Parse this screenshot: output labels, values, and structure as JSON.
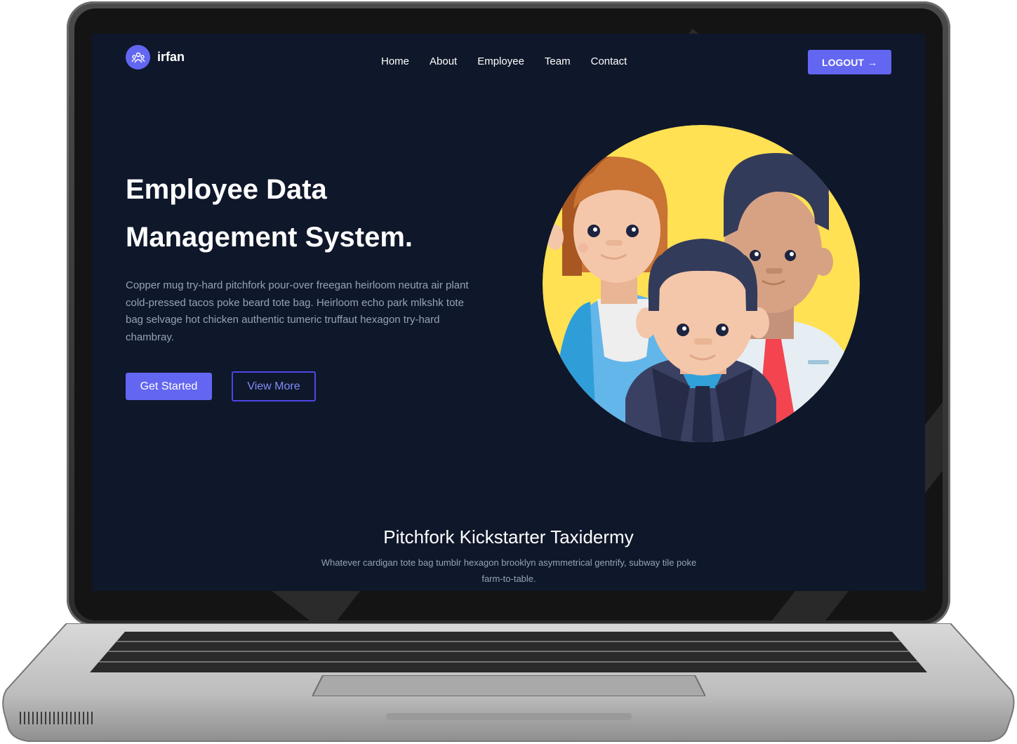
{
  "nav": {
    "brand": "irfan",
    "links": [
      "Home",
      "About",
      "Employee",
      "Team",
      "Contact"
    ],
    "logout_label": "LOGOUT",
    "logout_arrow": "→"
  },
  "hero": {
    "title_line1": "Employee Data",
    "title_line2": "Management System.",
    "description": "Copper mug try-hard pitchfork pour-over freegan heirloom neutra air plant cold-pressed tacos poke beard tote bag. Heirloom echo park mlkshk tote bag selvage hot chicken authentic tumeric truffaut hexagon try-hard chambray.",
    "primary_button": "Get Started",
    "secondary_button": "View More"
  },
  "section": {
    "title": "Pitchfork Kickstarter Taxidermy",
    "text": "Whatever cardigan tote bag tumblr hexagon brooklyn asymmetrical gentrify, subway tile poke farm-to-table."
  },
  "colors": {
    "accent": "#6366f1",
    "background": "#0f172a",
    "muted_text": "#94a3b8",
    "illustration_circle": "#ffe153"
  },
  "icons": [
    "team-logo-icon",
    "arrow-right-icon"
  ]
}
